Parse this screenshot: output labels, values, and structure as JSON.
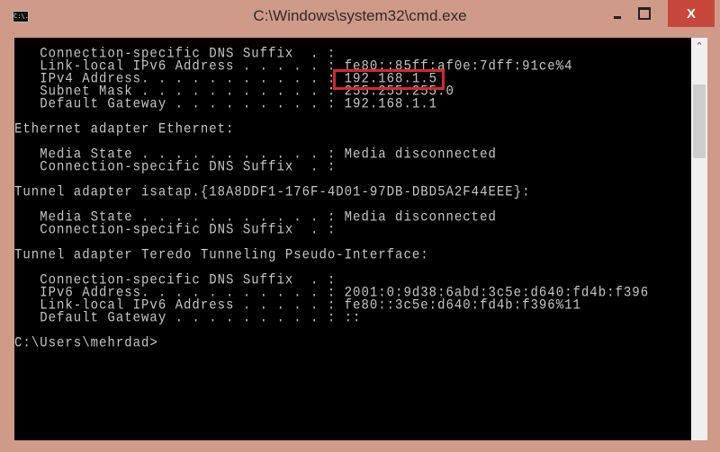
{
  "window": {
    "title": "C:\\Windows\\system32\\cmd.exe",
    "icon": "cmd-icon",
    "icon_text": "C:\\."
  },
  "controls": {
    "minimize": "minimize-icon",
    "maximize": "maximize-icon",
    "close": "X"
  },
  "highlight_color": "#d9262c",
  "console": {
    "lines": [
      "   Connection-specific DNS Suffix  . :",
      "   Link-local IPv6 Address . . . . . : fe80::85ff:af0e:7dff:91ce%4",
      "   IPv4 Address. . . . . . . . . . . : 192.168.1.5",
      "   Subnet Mask . . . . . . . . . . . : 255.255.255.0",
      "   Default Gateway . . . . . . . . . : 192.168.1.1",
      "",
      "Ethernet adapter Ethernet:",
      "",
      "   Media State . . . . . . . . . . . : Media disconnected",
      "   Connection-specific DNS Suffix  . :",
      "",
      "Tunnel adapter isatap.{18A8DDF1-176F-4D01-97DB-DBD5A2F44EEE}:",
      "",
      "   Media State . . . . . . . . . . . : Media disconnected",
      "   Connection-specific DNS Suffix  . :",
      "",
      "Tunnel adapter Teredo Tunneling Pseudo-Interface:",
      "",
      "   Connection-specific DNS Suffix  . :",
      "   IPv6 Address. . . . . . . . . . . : 2001:0:9d38:6abd:3c5e:d640:fd4b:f396",
      "   Link-local IPv6 Address . . . . . : fe80::3c5e:d640:fd4b:f396%11",
      "   Default Gateway . . . . . . . . . : ::",
      "",
      "C:\\Users\\mehrdad>"
    ]
  }
}
